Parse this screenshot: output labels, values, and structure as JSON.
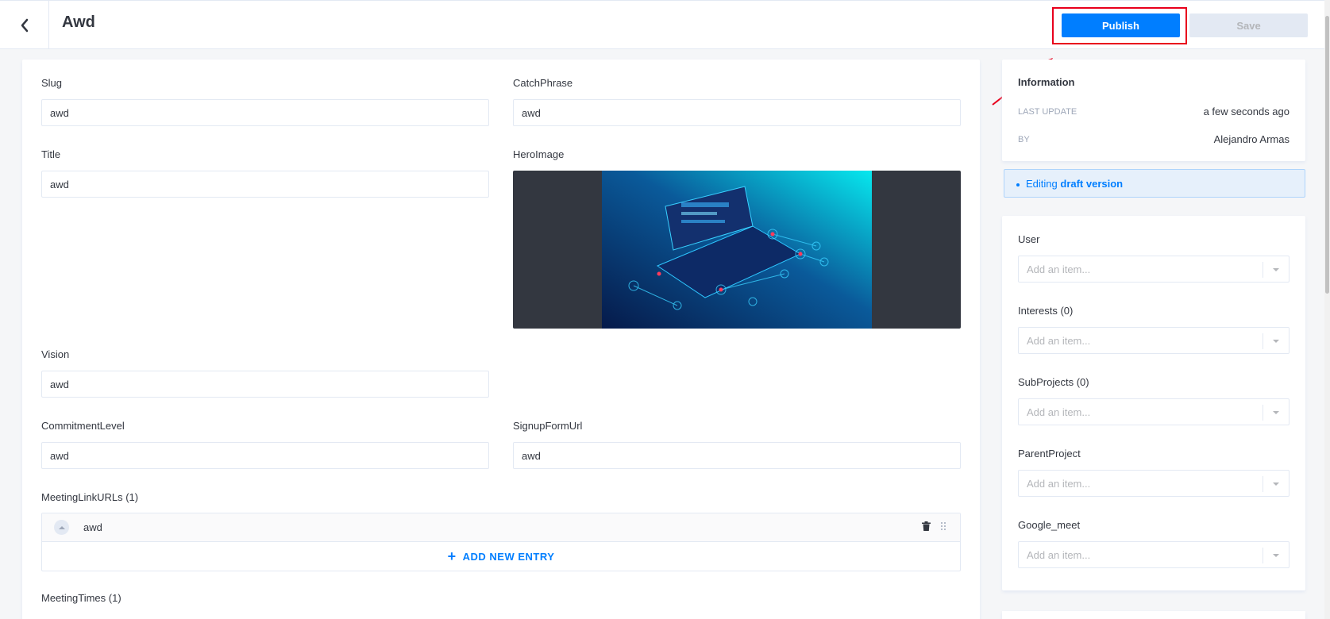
{
  "header": {
    "title": "Awd",
    "publish_label": "Publish",
    "save_label": "Save"
  },
  "form": {
    "slug": {
      "label": "Slug",
      "value": "awd"
    },
    "catchphrase": {
      "label": "CatchPhrase",
      "value": "awd"
    },
    "title": {
      "label": "Title",
      "value": "awd"
    },
    "hero_image": {
      "label": "HeroImage"
    },
    "vision": {
      "label": "Vision",
      "value": "awd"
    },
    "commitment_level": {
      "label": "CommitmentLevel",
      "value": "awd"
    },
    "signup_form_url": {
      "label": "SignupFormUrl",
      "value": "awd"
    },
    "meeting_link_urls": {
      "label": "MeetingLinkURLs (1)",
      "entries": [
        "awd"
      ],
      "add_label": "ADD NEW ENTRY"
    },
    "meeting_times": {
      "label": "MeetingTimes (1)"
    }
  },
  "sidebar": {
    "information": {
      "title": "Information",
      "last_update_key": "LAST UPDATE",
      "last_update_value": "a few seconds ago",
      "by_key": "BY",
      "by_value": "Alejandro Armas"
    },
    "draft": {
      "prefix": "Editing",
      "emphasis": "draft version"
    },
    "relations": [
      {
        "label": "User",
        "placeholder": "Add an item..."
      },
      {
        "label": "Interests (0)",
        "placeholder": "Add an item..."
      },
      {
        "label": "SubProjects (0)",
        "placeholder": "Add an item..."
      },
      {
        "label": "ParentProject",
        "placeholder": "Add an item..."
      },
      {
        "label": "Google_meet",
        "placeholder": "Add an item..."
      }
    ]
  },
  "colors": {
    "accent": "#007eff",
    "highlight": "#e8001c"
  }
}
